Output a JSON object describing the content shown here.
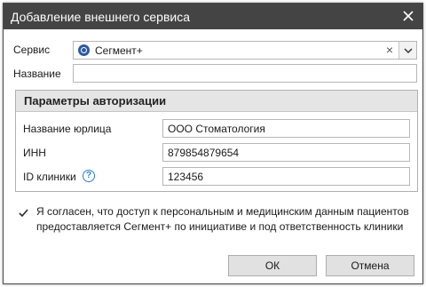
{
  "window": {
    "title": "Добавление внешнего сервиса",
    "close_icon": "close-icon"
  },
  "form": {
    "service_label": "Сервис",
    "service_value": "Сегмент+",
    "service_icon": "segment-logo-icon",
    "name_label": "Название",
    "name_value": ""
  },
  "auth": {
    "title": "Параметры авторизации",
    "legal_name_label": "Название юрлица",
    "legal_name_value": "ООО Стоматология",
    "inn_label": "ИНН",
    "inn_value": "879854879654",
    "clinic_id_label": "ID клиники",
    "clinic_id_value": "123456",
    "help_glyph": "?"
  },
  "consent": {
    "checked": true,
    "text": "Я согласен, что доступ к персональным и медицинским данным пациентов предоставляется Сегмент+ по инициативе и под ответственность клиники"
  },
  "buttons": {
    "ok": "ОК",
    "cancel": "Отмена"
  },
  "colors": {
    "titlebar": "#444444",
    "accent": "#2a7fd0",
    "group_header": "#e5e5e5"
  }
}
